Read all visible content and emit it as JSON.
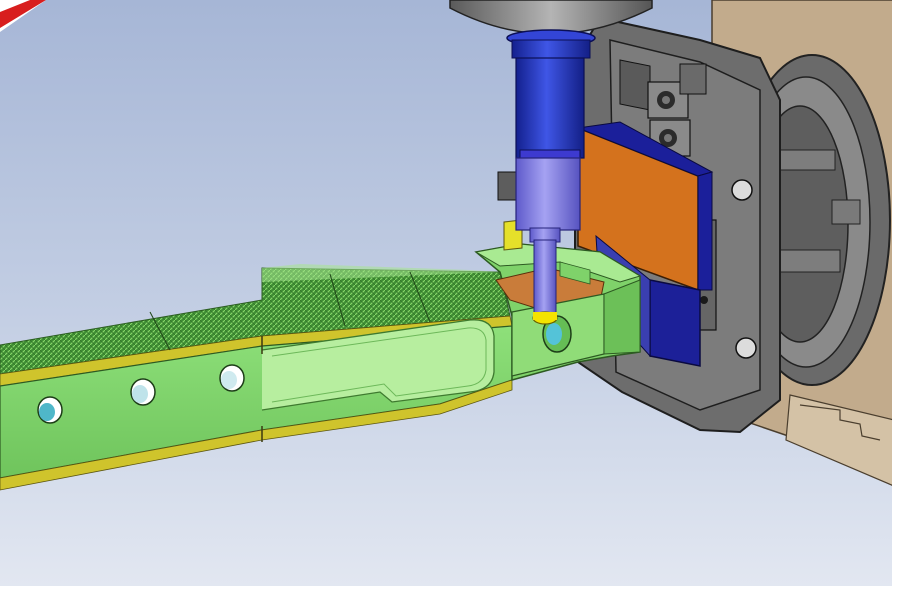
{
  "colors": {
    "background_top": "#a9bad8",
    "background_bottom": "#dde3ef",
    "part_green": "#8fe07a",
    "part_green_dark": "#4d9a3c",
    "part_edge_yellow": "#c9c12a",
    "fixture_gray": "#6f6f6f",
    "fixture_gray_light": "#9a9a9a",
    "clamp_orange": "#d2711c",
    "clamp_blue": "#1b1f9a",
    "spindle_blue": "#1f2fb8",
    "tool_lavender": "#8a86e8",
    "tool_tip_yellow": "#f2e200",
    "machine_tan": "#bfa98a",
    "corner_red": "#d81e1e"
  }
}
